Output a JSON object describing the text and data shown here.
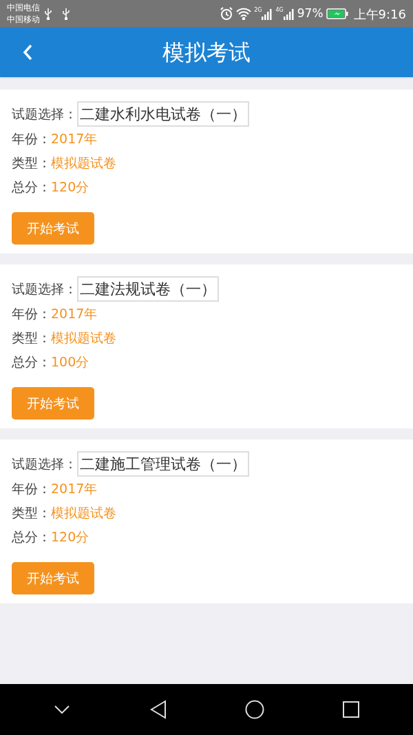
{
  "status_bar": {
    "carriers": [
      "中国电信",
      "中国移动"
    ],
    "network_labels": [
      "2G",
      "4G"
    ],
    "battery": "97%",
    "time": "上午9:16"
  },
  "header": {
    "title": "模拟考试"
  },
  "exams": [
    {
      "select_label": "试题选择：",
      "paper": "二建水利水电试卷（一）",
      "fields": [
        {
          "label": "年份：",
          "value": "2017年"
        },
        {
          "label": "类型：",
          "value": "模拟题试卷"
        },
        {
          "label": "总分：",
          "value": "120分"
        }
      ],
      "button": "开始考试"
    },
    {
      "select_label": "试题选择：",
      "paper": "二建法规试卷（一）",
      "fields": [
        {
          "label": "年份：",
          "value": "2017年"
        },
        {
          "label": "类型：",
          "value": "模拟题试卷"
        },
        {
          "label": "总分：",
          "value": "100分"
        }
      ],
      "button": "开始考试"
    },
    {
      "select_label": "试题选择：",
      "paper": "二建施工管理试卷（一）",
      "fields": [
        {
          "label": "年份：",
          "value": "2017年"
        },
        {
          "label": "类型：",
          "value": "模拟题试卷"
        },
        {
          "label": "总分：",
          "value": "120分"
        }
      ],
      "button": "开始考试"
    }
  ]
}
